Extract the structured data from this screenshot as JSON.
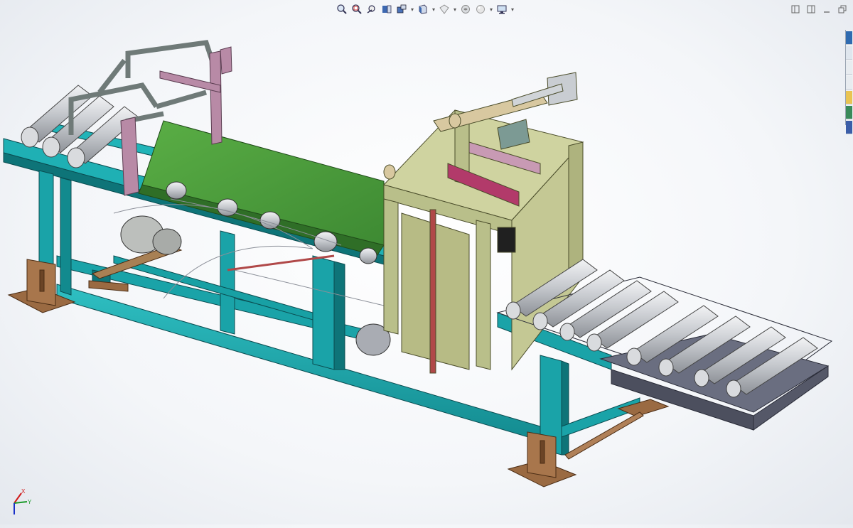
{
  "app": {
    "viewport": "3d-model-view"
  },
  "heads_up_toolbar": [
    {
      "name": "zoom-to-fit",
      "icon": "zoom-to-fit-icon"
    },
    {
      "name": "zoom-to-area",
      "icon": "zoom-to-area-icon"
    },
    {
      "name": "previous-view",
      "icon": "previous-view-icon"
    },
    {
      "name": "section-view",
      "icon": "section-view-icon"
    },
    {
      "name": "dynamic-annotation",
      "icon": "dynamic-annotation-icon"
    },
    {
      "name": "view-orientation",
      "icon": "view-orientation-icon",
      "dropdown": true
    },
    {
      "name": "display-style",
      "icon": "display-style-icon",
      "dropdown": true
    },
    {
      "name": "hide-show-items",
      "icon": "hide-show-icon",
      "dropdown": true
    },
    {
      "name": "edit-appearance",
      "icon": "appearance-icon",
      "dropdown": true
    },
    {
      "name": "apply-scene",
      "icon": "scene-icon",
      "dropdown": true
    },
    {
      "name": "view-settings",
      "icon": "monitor-icon",
      "dropdown": true
    }
  ],
  "window_controls": [
    "tile-left-icon",
    "tile-right-icon",
    "minimize-icon",
    "restore-icon"
  ],
  "triad": {
    "x_label": "X",
    "y_label": "Y",
    "colors": {
      "x": "#d01818",
      "y": "#1a9a2a",
      "z": "#1830c8"
    }
  },
  "colors": {
    "frame": "#1aa3a8",
    "frame_dark": "#0e7478",
    "belt": "#4c9a3c",
    "head": "#b9bf8a",
    "gray_rail": "#6a6e80",
    "pink": "#b88aa6",
    "feet": "#9a6a42",
    "roller": "#c9ccd0"
  }
}
